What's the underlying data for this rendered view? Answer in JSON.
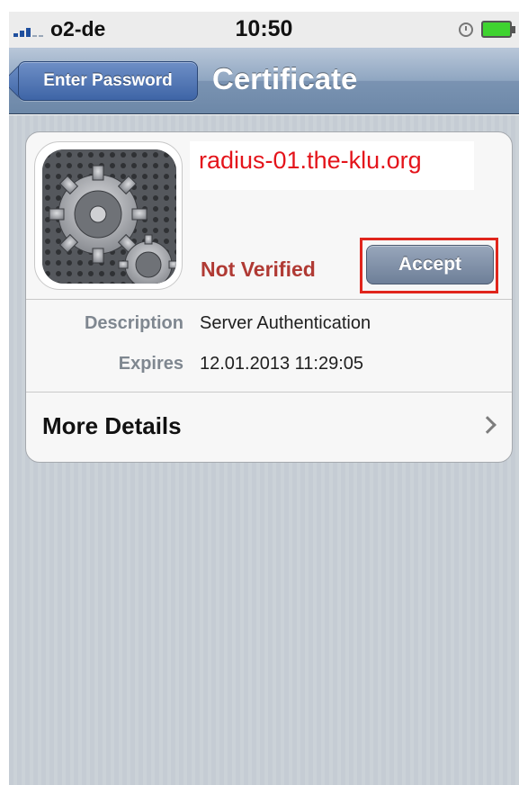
{
  "status_bar": {
    "carrier": "o2-de",
    "time": "10:50",
    "signal_icon": "signal-bars-icon",
    "alarm_icon": "alarm-clock-icon",
    "battery_icon": "battery-full-icon",
    "battery_color": "#3fd330"
  },
  "nav": {
    "back_label": "Enter Password",
    "title": "Certificate"
  },
  "certificate": {
    "icon": "settings-gears-icon",
    "name": "radius-01.the-klu.org",
    "status": "Not Verified",
    "accept_label": "Accept",
    "details": [
      {
        "label": "Description",
        "value": "Server Authentication"
      },
      {
        "label": "Expires",
        "value": "12.01.2013 11:29:05"
      }
    ],
    "more_details_label": "More Details"
  },
  "colors": {
    "nav_bar": "#7a93b2",
    "back_button": "#3e65a6",
    "accept_button": "#6e7f98",
    "highlight": "#e0251c",
    "name_text": "#e4141b",
    "not_verified_text": "#b03a34",
    "pinstripe": "#c5ccd4"
  }
}
